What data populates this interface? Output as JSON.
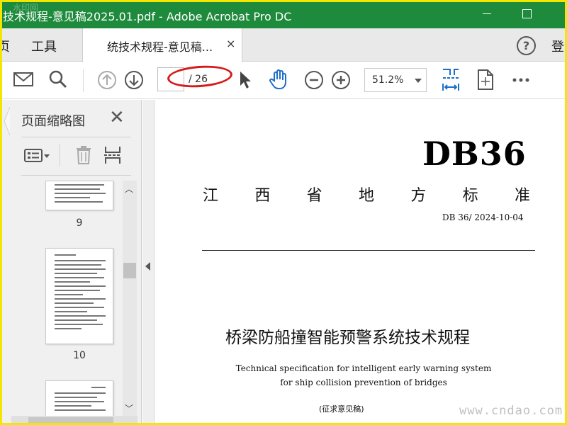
{
  "window": {
    "title": "技术规程-意见稿2025.01.pdf - Adobe Acrobat Pro DC",
    "watermark": "水印网"
  },
  "menubar": {
    "home_fragment": "页",
    "tools": "工具",
    "tab_label": "统技术规程-意见稿...",
    "tab_close": "×",
    "help": "?",
    "login_fragment": "登"
  },
  "toolbar": {
    "page_current": "",
    "page_total": "/ 26",
    "zoom": "51.2%"
  },
  "thumbnails_panel": {
    "title": "页面缩略图",
    "close": "✕",
    "pages": [
      {
        "number": "9"
      },
      {
        "number": "10"
      },
      {
        "number": ""
      }
    ]
  },
  "document": {
    "code": "DB36",
    "province_chars": [
      "江",
      "西",
      "省",
      "地",
      "方",
      "标",
      "准"
    ],
    "standard_number": "DB 36/  2024-10-04",
    "title_zh": "桥梁防船撞智能预警系统技术规程",
    "title_en_line1": "Technical specification for intelligent early warning system",
    "title_en_line2": "for ship collision prevention of bridges",
    "draft_label": "(征求意见稿)"
  },
  "site_watermark": "www.cndao.com",
  "colors": {
    "titlebar": "#1e8a3c",
    "accent_blue": "#1c6fc9",
    "annotation_red": "#d61a1a",
    "frame_yellow": "#f5e600"
  }
}
